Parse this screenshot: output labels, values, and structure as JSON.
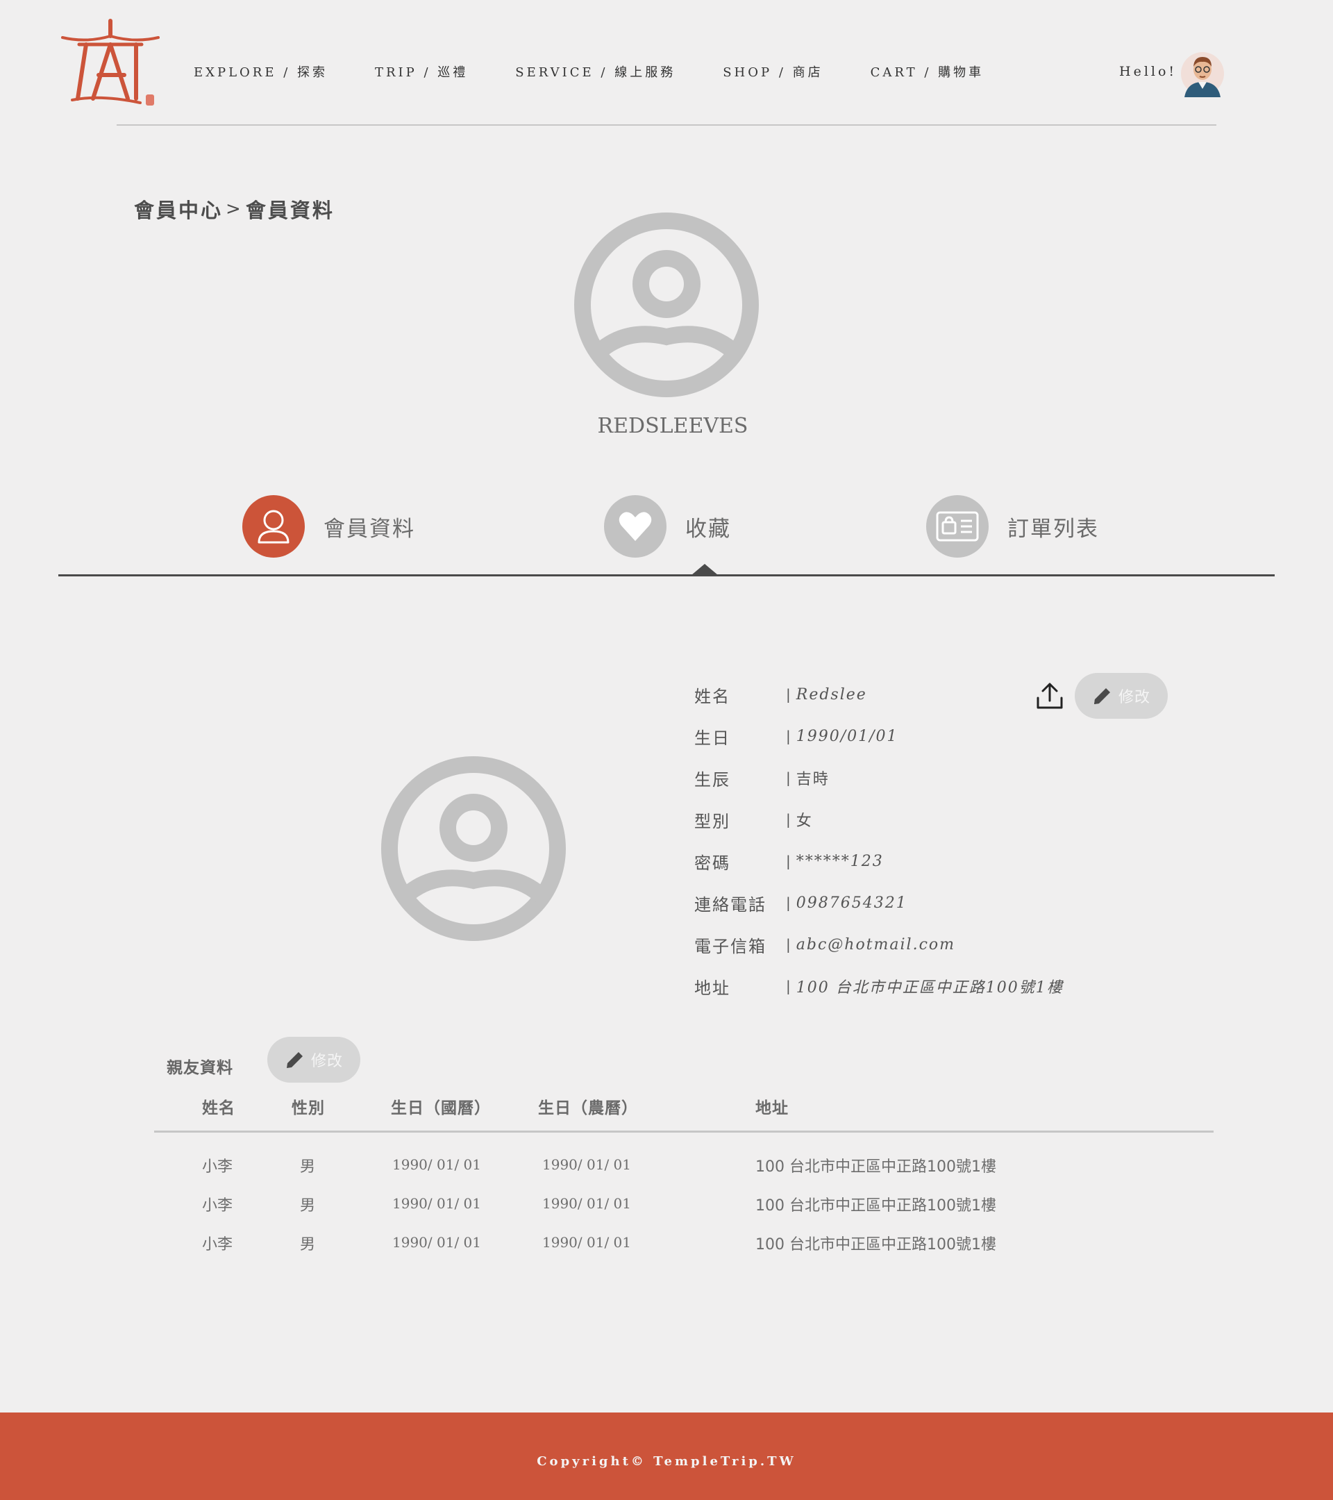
{
  "nav": {
    "items": [
      {
        "label": "EXPLORE / 探索"
      },
      {
        "label": "TRIP / 巡禮"
      },
      {
        "label": "SERVICE / 線上服務"
      },
      {
        "label": "SHOP / 商店"
      },
      {
        "label": "CART / 購物車"
      }
    ],
    "greeting": "Hello!"
  },
  "breadcrumb": {
    "parent": "會員中心",
    "separator": ">",
    "current": "會員資料"
  },
  "profile": {
    "username": "REDSLEEVES"
  },
  "tabs": [
    {
      "label": "會員資料",
      "icon": "user-icon",
      "active": true
    },
    {
      "label": "收藏",
      "icon": "heart-icon",
      "active": false
    },
    {
      "label": "訂單列表",
      "icon": "order-list-icon",
      "active": false
    }
  ],
  "member": {
    "edit_label": "修改",
    "fields": [
      {
        "label": "姓名",
        "value": "Redslee"
      },
      {
        "label": "生日",
        "value": "1990/01/01"
      },
      {
        "label": "生辰",
        "value": "吉時"
      },
      {
        "label": "型別",
        "value": "女"
      },
      {
        "label": "密碼",
        "value": "******123"
      },
      {
        "label": "連絡電話",
        "value": "0987654321"
      },
      {
        "label": "電子信箱",
        "value": "abc@hotmail.com"
      },
      {
        "label": "地址",
        "value": "100 台北市中正區中正路100號1樓"
      }
    ]
  },
  "friends": {
    "title": "親友資料",
    "edit_label": "修改",
    "headers": [
      "姓名",
      "性別",
      "生日（國曆）",
      "生日（農曆）",
      "地址"
    ],
    "rows": [
      {
        "name": "小李",
        "gender": "男",
        "birthday_solar": "1990/ 01/ 01",
        "birthday_lunar": "1990/ 01/ 01",
        "address": "100 台北市中正區中正路100號1樓"
      },
      {
        "name": "小李",
        "gender": "男",
        "birthday_solar": "1990/ 01/ 01",
        "birthday_lunar": "1990/ 01/ 01",
        "address": "100 台北市中正區中正路100號1樓"
      },
      {
        "name": "小李",
        "gender": "男",
        "birthday_solar": "1990/ 01/ 01",
        "birthday_lunar": "1990/ 01/ 01",
        "address": "100 台北市中正區中正路100號1樓"
      }
    ]
  },
  "footer": {
    "copyright": "Copyright© TempleTrip.TW"
  },
  "colors": {
    "accent": "#cc543a",
    "background": "#f0efef",
    "inactive_icon": "#c2c2c2"
  }
}
